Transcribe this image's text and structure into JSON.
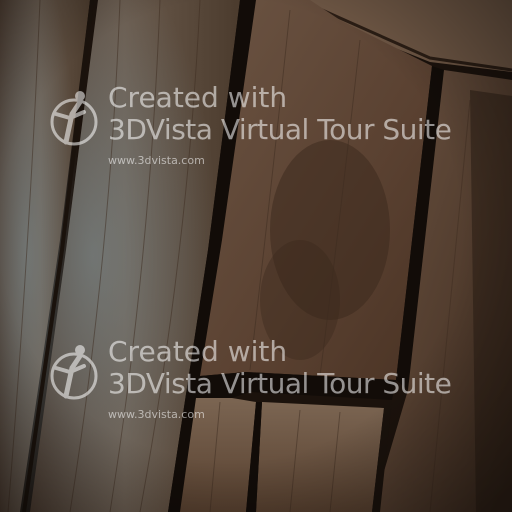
{
  "scene": {
    "subject": "weathered-wooden-planks",
    "colors": {
      "plank_light": "#7a6552",
      "plank_mid": "#5e4634",
      "plank_dark": "#3a2a1f",
      "gap_shadow": "#120c08",
      "blue_weathering": "#6f7f86"
    }
  },
  "watermarks": [
    {
      "line1": "Created with",
      "line2": "3DVista Virtual Tour Suite",
      "url": "www.3dvista.com",
      "icon": "3dvista-logo-icon"
    },
    {
      "line1": "Created with",
      "line2": "3DVista Virtual Tour Suite",
      "url": "www.3dvista.com",
      "icon": "3dvista-logo-icon"
    }
  ]
}
